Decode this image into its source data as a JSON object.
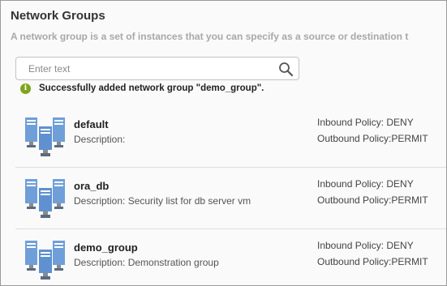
{
  "header": {
    "title": "Network Groups",
    "subtitle": "A network group is a set of instances that you can specify as a source or destination t"
  },
  "search": {
    "placeholder": "Enter text",
    "value": "",
    "icon": "search-icon"
  },
  "notification": {
    "icon": "info-icon",
    "text": "Successfully added network group \"demo_group\".",
    "color": "#7fa51c"
  },
  "groups": [
    {
      "name": "default",
      "description": "Description:",
      "inbound": "Inbound Policy: DENY",
      "outbound": "Outbound Policy:PERMIT",
      "icon": "server-group-icon"
    },
    {
      "name": "ora_db",
      "description": "Description: Security list for db server vm",
      "inbound": "Inbound Policy: DENY",
      "outbound": "Outbound Policy:PERMIT",
      "icon": "server-group-icon"
    },
    {
      "name": "demo_group",
      "description": "Description: Demonstration group",
      "inbound": "Inbound Policy: DENY",
      "outbound": "Outbound Policy:PERMIT",
      "icon": "server-group-icon"
    }
  ],
  "colors": {
    "server_blue": "#6f9fd8",
    "server_dark": "#3d6fae",
    "success_green": "#7fa51c"
  }
}
